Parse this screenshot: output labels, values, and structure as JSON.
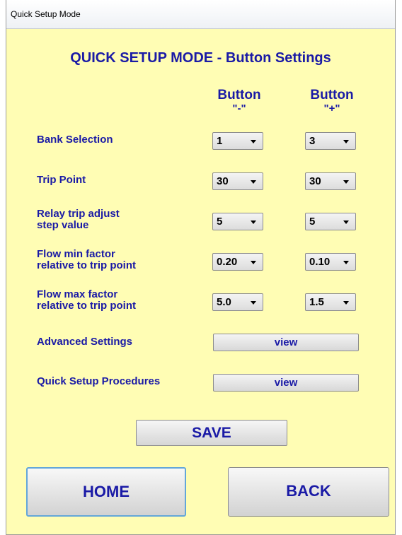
{
  "window": {
    "title": "Quick Setup Mode"
  },
  "heading": "QUICK SETUP MODE - Button Settings",
  "columns": {
    "minus": {
      "title": "Button",
      "sub": "\"-\""
    },
    "plus": {
      "title": "Button",
      "sub": "\"+\""
    }
  },
  "rows": [
    {
      "label_lines": [
        "Bank Selection"
      ],
      "minus": "1",
      "plus": "3"
    },
    {
      "label_lines": [
        "Trip Point"
      ],
      "minus": "30",
      "plus": "30"
    },
    {
      "label_lines": [
        "Relay trip adjust",
        "step value"
      ],
      "minus": "5",
      "plus": "5"
    },
    {
      "label_lines": [
        "Flow min factor",
        "relative to trip point"
      ],
      "minus": "0.20",
      "plus": "0.10"
    },
    {
      "label_lines": [
        "Flow max factor",
        "relative to trip point"
      ],
      "minus": "5.0",
      "plus": "1.5"
    }
  ],
  "advanced": {
    "label": "Advanced Settings",
    "button": "view"
  },
  "procedures": {
    "label": "Quick Setup Procedures",
    "button": "view"
  },
  "save": "SAVE",
  "home": "HOME",
  "back": "BACK"
}
